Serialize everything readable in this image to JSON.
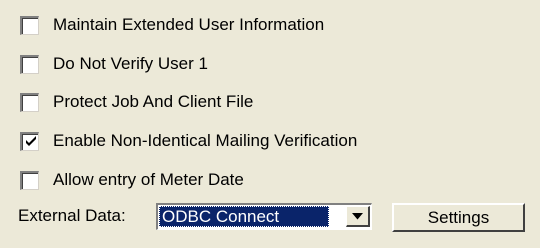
{
  "options": [
    {
      "label": "Maintain Extended User Information",
      "checked": false
    },
    {
      "label": "Do Not Verify User 1",
      "checked": false
    },
    {
      "label": "Protect Job And Client File",
      "checked": false
    },
    {
      "label": "Enable Non-Identical Mailing Verification",
      "checked": true
    },
    {
      "label": "Allow entry of Meter Date",
      "checked": false
    }
  ],
  "external_data": {
    "label": "External Data:",
    "selected": "ODBC Connect",
    "arrow_icon": "chevron-down-icon"
  },
  "settings_button": {
    "label": "Settings"
  },
  "colors": {
    "panel_bg": "#ece9d8",
    "selection_bg": "#0a246a",
    "selection_text": "#ffffff"
  }
}
